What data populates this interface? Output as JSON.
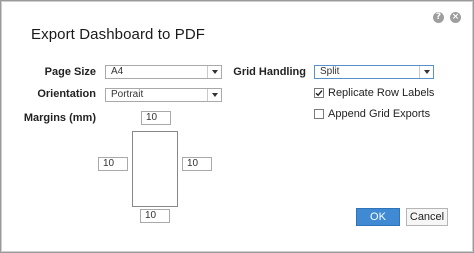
{
  "dialog": {
    "title": "Export Dashboard to PDF",
    "icons": [
      "help-icon",
      "close-icon"
    ]
  },
  "page_size": {
    "label": "Page Size",
    "value": "A4"
  },
  "orientation": {
    "label": "Orientation",
    "value": "Portrait"
  },
  "margins": {
    "label": "Margins (mm)",
    "top": "10",
    "left": "10",
    "right": "10",
    "bottom": "10"
  },
  "grid_handling": {
    "label": "Grid Handling",
    "value": "Split"
  },
  "options": {
    "replicate_row_labels": {
      "label": "Replicate Row Labels",
      "checked": true
    },
    "append_grid_exports": {
      "label": "Append Grid Exports",
      "checked": false
    }
  },
  "buttons": {
    "ok": "OK",
    "cancel": "Cancel"
  },
  "colors": {
    "primary": "#3f8ad2",
    "focus_border": "#5a90c9"
  }
}
